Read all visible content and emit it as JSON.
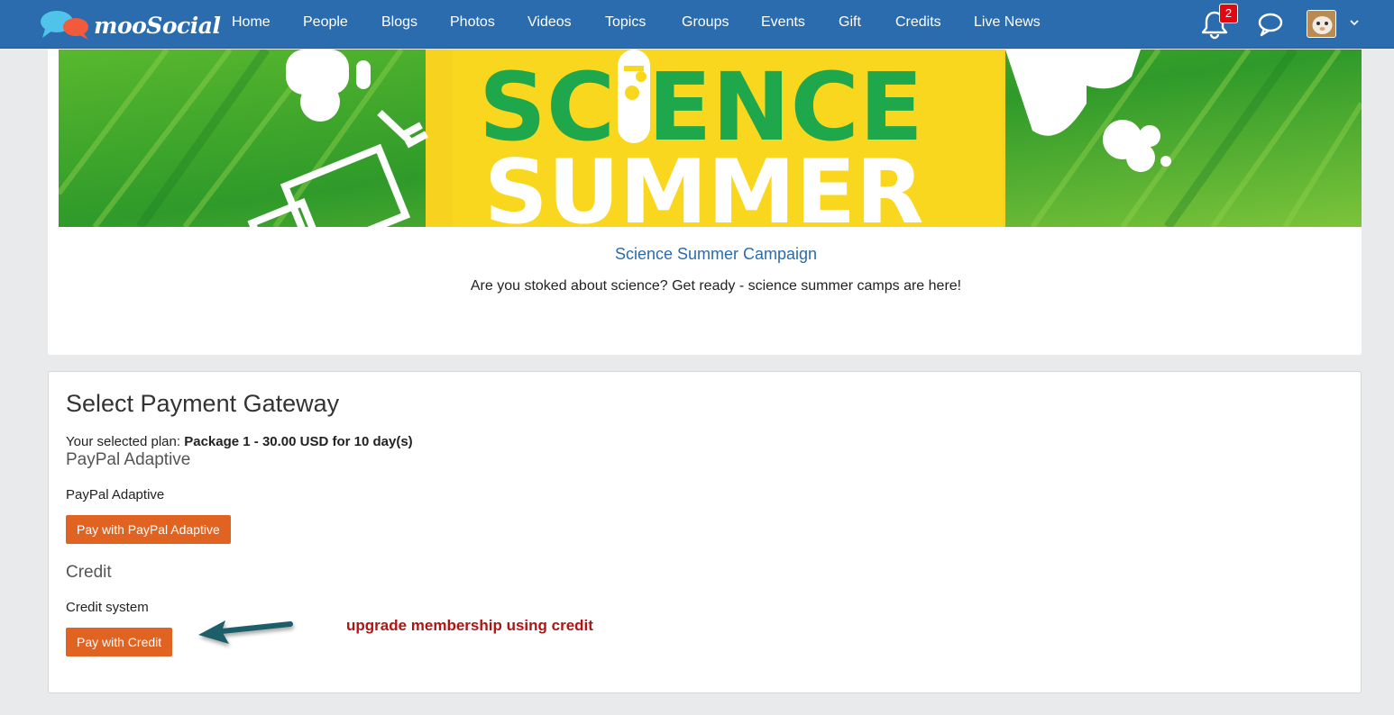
{
  "app": {
    "brand": "mooSocial"
  },
  "nav": {
    "items": [
      {
        "label": "Home"
      },
      {
        "label": "People"
      },
      {
        "label": "Blogs"
      },
      {
        "label": "Photos"
      },
      {
        "label": "Videos"
      },
      {
        "label": "Topics"
      },
      {
        "label": "Groups"
      },
      {
        "label": "Events"
      },
      {
        "label": "Gift"
      },
      {
        "label": "Credits"
      },
      {
        "label": "Live News"
      }
    ],
    "notification_count": "2"
  },
  "campaign": {
    "banner_text_line1": "SCIENCE",
    "banner_text_line2": "SUMMER",
    "title": "Science Summer Campaign",
    "description": "Are you stoked about science? Get ready - science summer camps are here!"
  },
  "payment": {
    "heading": "Select Payment Gateway",
    "plan_prefix": "Your selected plan: ",
    "plan_value": "Package 1 - 30.00 USD for 10 day(s)",
    "gateways": [
      {
        "section": "PayPal Adaptive",
        "name": "PayPal Adaptive",
        "button": "Pay with PayPal Adaptive"
      },
      {
        "section": "Credit",
        "name": "Credit system",
        "button": "Pay with Credit"
      }
    ],
    "annotation": "upgrade membership using credit"
  },
  "colors": {
    "nav_bg": "#2a6cad",
    "button_bg": "#e06321",
    "annotation": "#b01515",
    "banner_green": "#2e9a2a",
    "banner_yellow": "#f7d21e"
  }
}
